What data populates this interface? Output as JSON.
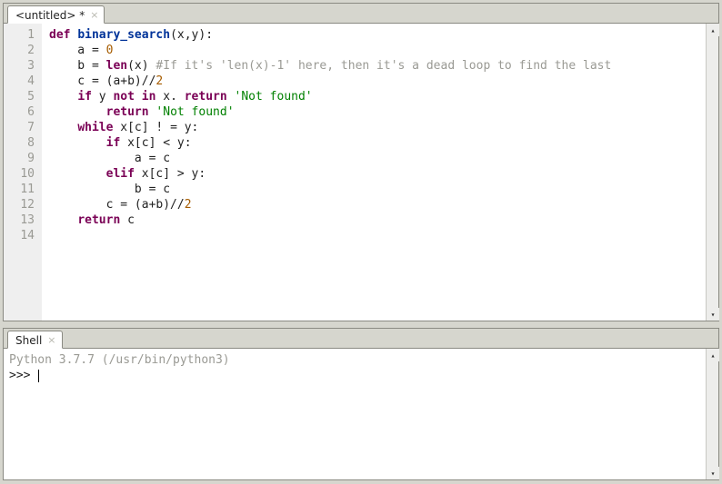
{
  "editor": {
    "tab_label": "<untitled> *",
    "line_numbers": [
      "1",
      "2",
      "3",
      "4",
      "5",
      "6",
      "7",
      "8",
      "9",
      "10",
      "11",
      "12",
      "13",
      "14"
    ],
    "code_lines": [
      [
        {
          "t": "def ",
          "c": "kw"
        },
        {
          "t": "binary_search",
          "c": "fn"
        },
        {
          "t": "(x,y):",
          "c": "op"
        }
      ],
      [
        {
          "t": "    a = ",
          "c": "op"
        },
        {
          "t": "0",
          "c": "num"
        }
      ],
      [
        {
          "t": "    b = ",
          "c": "op"
        },
        {
          "t": "len",
          "c": "kw"
        },
        {
          "t": "(x) ",
          "c": "op"
        },
        {
          "t": "#If it's 'len(x)-1' here, then it's a dead loop to find the last",
          "c": "cm"
        }
      ],
      [
        {
          "t": "    c = (a+b)//",
          "c": "op"
        },
        {
          "t": "2",
          "c": "num"
        }
      ],
      [
        {
          "t": "    ",
          "c": "op"
        },
        {
          "t": "if",
          "c": "kw"
        },
        {
          "t": " y ",
          "c": "op"
        },
        {
          "t": "not in",
          "c": "kw"
        },
        {
          "t": " x. ",
          "c": "op"
        },
        {
          "t": "return",
          "c": "kw"
        },
        {
          "t": " ",
          "c": "op"
        },
        {
          "t": "'Not found'",
          "c": "str"
        }
      ],
      [
        {
          "t": "        ",
          "c": "op"
        },
        {
          "t": "return",
          "c": "kw"
        },
        {
          "t": " ",
          "c": "op"
        },
        {
          "t": "'Not found'",
          "c": "str"
        }
      ],
      [
        {
          "t": "    ",
          "c": "op"
        },
        {
          "t": "while",
          "c": "kw"
        },
        {
          "t": " x[c] ! = y:",
          "c": "op"
        }
      ],
      [
        {
          "t": "        ",
          "c": "op"
        },
        {
          "t": "if",
          "c": "kw"
        },
        {
          "t": " x[c] < y:",
          "c": "op"
        }
      ],
      [
        {
          "t": "            a = c",
          "c": "op"
        }
      ],
      [
        {
          "t": "        ",
          "c": "op"
        },
        {
          "t": "elif",
          "c": "kw"
        },
        {
          "t": " x[c] > y:",
          "c": "op"
        }
      ],
      [
        {
          "t": "            b = c",
          "c": "op"
        }
      ],
      [
        {
          "t": "        c = (a+b)//",
          "c": "op"
        },
        {
          "t": "2",
          "c": "num"
        }
      ],
      [
        {
          "t": "    ",
          "c": "op"
        },
        {
          "t": "return",
          "c": "kw"
        },
        {
          "t": " c",
          "c": "op"
        }
      ],
      [
        {
          "t": "",
          "c": "op"
        }
      ]
    ]
  },
  "shell": {
    "tab_label": "Shell",
    "banner": "Python 3.7.7 (/usr/bin/python3)",
    "prompt": ">>> "
  },
  "scroll_arrows": {
    "up": "▴",
    "down": "▾"
  }
}
